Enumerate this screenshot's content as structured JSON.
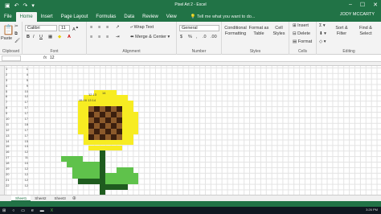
{
  "window": {
    "title": "Pixel Art 2 - Excel",
    "user": "JODY MCCARTY",
    "tell_me": "Tell me what you want to do..."
  },
  "tabs": [
    "File",
    "Home",
    "Insert",
    "Page Layout",
    "Formulas",
    "Data",
    "Review",
    "View",
    "Help"
  ],
  "ribbon": {
    "clipboard": {
      "paste": "Paste",
      "label": "Clipboard"
    },
    "font": {
      "name": "Calibri",
      "size": "11",
      "bold": "B",
      "italic": "I",
      "underline": "U",
      "label": "Font"
    },
    "alignment": {
      "wrap_text": "Wrap Text",
      "merge_center": "Merge & Center",
      "label": "Alignment"
    },
    "number": {
      "format": "General",
      "currency": "$",
      "percent": "%",
      "comma": ",",
      "label": "Number"
    },
    "styles": {
      "conditional": "Conditional Formatting",
      "format_table": "Format as Table",
      "cell_styles": "Cell Styles",
      "label": "Styles"
    },
    "cells": {
      "insert": "Insert",
      "delete": "Delete",
      "format": "Format",
      "label": "Cells"
    },
    "editing": {
      "sort_filter": "Sort & Filter",
      "find_select": "Find & Select",
      "label": "Editing"
    }
  },
  "formula_bar": {
    "name_box": "",
    "fx": "fx",
    "value": "12"
  },
  "rows": [
    [
      "1",
      "1"
    ],
    [
      "2",
      "4"
    ],
    [
      "3",
      "5"
    ],
    [
      "4",
      "9"
    ],
    [
      "5",
      "10"
    ],
    [
      "6",
      "12"
    ],
    [
      "7",
      "17"
    ],
    [
      "8",
      "17"
    ],
    [
      "9",
      "17"
    ],
    [
      "10",
      "17"
    ],
    [
      "11",
      "18"
    ],
    [
      "12",
      "17"
    ],
    [
      "13",
      "17"
    ],
    [
      "14",
      "15"
    ],
    [
      "15",
      "13"
    ],
    [
      "16",
      "12"
    ],
    [
      "17",
      "11"
    ],
    [
      "18",
      "10"
    ],
    [
      "19",
      "12"
    ],
    [
      "20",
      "12"
    ],
    [
      "21",
      "12"
    ],
    [
      "22",
      "12"
    ]
  ],
  "pixel_labels": {
    "a": "14",
    "b": "12 13",
    "c": "15 16 13 14"
  },
  "sheets": [
    "Sheet1",
    "Sheet2",
    "Sheet3"
  ],
  "taskbar": {
    "clock": "3:26 PM"
  },
  "colors": {
    "accent": "#217346",
    "petal": "#f7ec22",
    "center": "#8b5a2b",
    "dark_center": "#3b1f0e",
    "leaf": "#5fc24b",
    "stem": "#1f5c1f"
  }
}
